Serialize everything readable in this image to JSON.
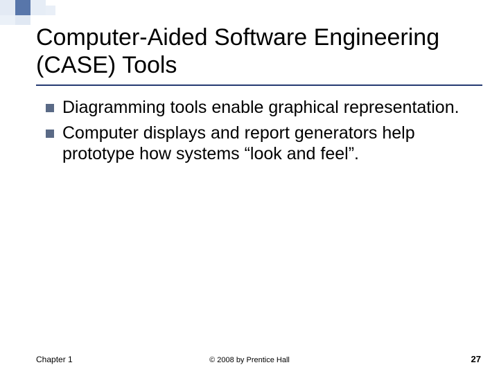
{
  "title": "Computer-Aided Software Engineering (CASE) Tools",
  "bullets": [
    "Diagramming tools enable graphical representation.",
    "Computer displays and report generators help prototype how systems “look and feel”."
  ],
  "footer": {
    "chapter": "Chapter 1",
    "copyright": "© 2008 by Prentice Hall",
    "page": "27"
  }
}
